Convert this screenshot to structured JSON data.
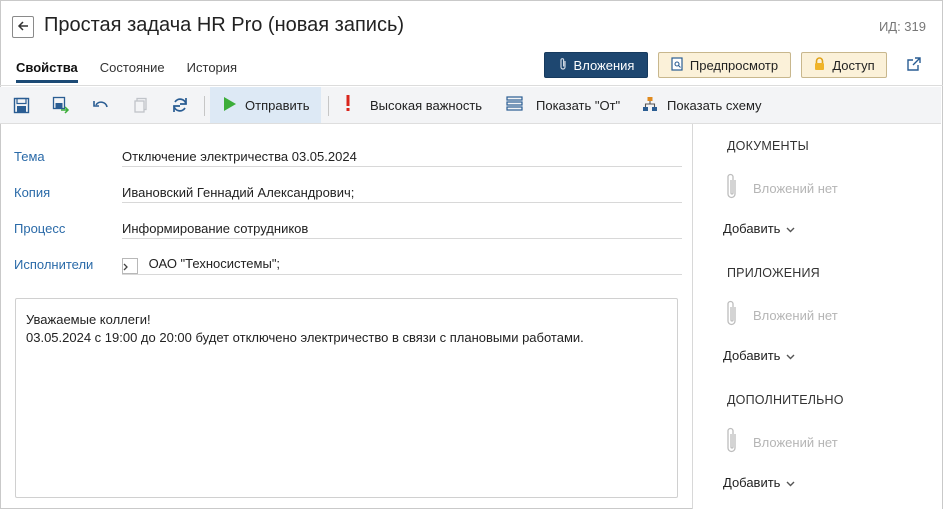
{
  "header": {
    "title": "Простая задача HR Pro (новая запись)",
    "record_id": "ИД: 319"
  },
  "tabs": [
    {
      "label": "Свойства",
      "active": true
    },
    {
      "label": "Состояние",
      "active": false
    },
    {
      "label": "История",
      "active": false
    }
  ],
  "actions": {
    "attachments": "Вложения",
    "preview": "Предпросмотр",
    "access": "Доступ"
  },
  "toolbar": {
    "send": "Отправить",
    "high_importance": "Высокая важность",
    "show_from": "Показать \"От\"",
    "show_scheme": "Показать схему"
  },
  "form": {
    "subject": {
      "label": "Тема",
      "value": "Отключение электричества 03.05.2024"
    },
    "copy": {
      "label": "Копия",
      "value": "Ивановский Геннадий Александрович;"
    },
    "process": {
      "label": "Процесс",
      "value": "Информирование сотрудников"
    },
    "executors": {
      "label": "Исполнители",
      "value": "ОАО \"Техносистемы\";"
    }
  },
  "body": {
    "line1": "Уважаемые коллеги!",
    "line2": "03.05.2024 с 19:00 до 20:00 будет отключено электричество в связи с плановыми работами."
  },
  "right_panel": {
    "documents": {
      "heading": "ДОКУМЕНТЫ",
      "empty": "Вложений нет",
      "add": "Добавить"
    },
    "applications": {
      "heading": "ПРИЛОЖЕНИЯ",
      "empty": "Вложений нет",
      "add": "Добавить"
    },
    "additional": {
      "heading": "ДОПОЛНИТЕЛЬНО",
      "empty": "Вложений нет",
      "add": "Добавить"
    }
  },
  "colors": {
    "accent": "#1e4770",
    "label_blue": "#2a6aa8",
    "send_green": "#3cae3a",
    "importance_red": "#d9251c"
  }
}
